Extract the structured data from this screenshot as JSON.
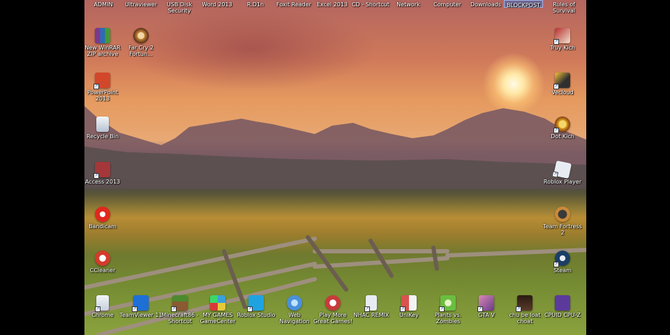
{
  "top_row": [
    {
      "label": "ADMIN",
      "highlight": false
    },
    {
      "label": "Ultraviewer",
      "highlight": false
    },
    {
      "label": "USB Disk Security",
      "highlight": false
    },
    {
      "label": "Word 2013",
      "highlight": false
    },
    {
      "label": "R.D1n",
      "highlight": false
    },
    {
      "label": "Foxit Reader",
      "highlight": false
    },
    {
      "label": "Excel 2013",
      "highlight": false
    },
    {
      "label": "CD - Shortcut",
      "highlight": false
    },
    {
      "label": "Network",
      "highlight": false
    },
    {
      "label": "Computer",
      "highlight": false
    },
    {
      "label": "Downloads",
      "highlight": false
    },
    {
      "label": "BLOCKPOST",
      "highlight": true
    },
    {
      "label": "Rules of Survival",
      "highlight": false
    }
  ],
  "left_column": [
    {
      "label": "New WinRAR ZIP archive",
      "icon": "winrar-icon",
      "color": "#7a3a8c"
    },
    {
      "label": "PowerPoint 2013",
      "icon": "powerpoint-icon",
      "color": "#d2472a"
    },
    {
      "label": "Recycle Bin",
      "icon": "recycle-bin-icon",
      "color": "#dfe6ef"
    },
    {
      "label": "Access 2013",
      "icon": "access-icon",
      "color": "#a4373a"
    },
    {
      "label": "Bandicam",
      "icon": "bandicam-icon",
      "color": "#e0281e"
    },
    {
      "label": "CCleaner",
      "icon": "ccleaner-icon",
      "color": "#d43b2a"
    }
  ],
  "second_column": [
    {
      "label": "Far Cry 2 Fortun...",
      "icon": "far-cry-icon",
      "color": "#c98a3a"
    }
  ],
  "right_column": [
    {
      "label": "Truy Kich",
      "icon": "truy-kich-icon",
      "color": "#b62d2d"
    },
    {
      "label": "Vecloud",
      "icon": "vecloud-icon",
      "color": "#2f2f2f"
    },
    {
      "label": "Dot Kich",
      "icon": "dot-kich-icon",
      "color": "#e0a020"
    },
    {
      "label": "Roblox Player",
      "icon": "roblox-player-icon",
      "color": "#e8ecf2"
    },
    {
      "label": "Team Fortress 2",
      "icon": "team-fortress-icon",
      "color": "#3a3a3a"
    },
    {
      "label": "Steam",
      "icon": "steam-icon",
      "color": "#1b3f66"
    }
  ],
  "bottom_row": [
    {
      "label": "Chrome",
      "icon": "chrome-icon",
      "color": "#e8ecf2"
    },
    {
      "label": "TeamViewer 11",
      "icon": "teamviewer-icon",
      "color": "#1e6fd6"
    },
    {
      "label": "Minecraft86 - Shortcut",
      "icon": "minecraft-icon",
      "color": "#4c8a2e"
    },
    {
      "label": "MY GAMES GameCenter",
      "icon": "my-games-icon",
      "color": "#3aa0d8"
    },
    {
      "label": "Roblox Studio",
      "icon": "roblox-studio-icon",
      "color": "#1fa3e0"
    },
    {
      "label": "Web Navigation",
      "icon": "web-navigation-icon",
      "color": "#4a90d9"
    },
    {
      "label": "Play More Great Games!",
      "icon": "play-more-icon",
      "color": "#c83b3b"
    },
    {
      "label": "NHAC REMIX",
      "icon": "nhac-remix-icon",
      "color": "#e8ecf2"
    },
    {
      "label": "UniKey",
      "icon": "unikey-icon",
      "color": "#d9534f"
    },
    {
      "label": "Plants vs. Zombies",
      "icon": "plants-vs-zombies-icon",
      "color": "#6abf3f"
    },
    {
      "label": "GTA V",
      "icon": "gta-v-icon",
      "color": "#d98ab3"
    },
    {
      "label": "chu be loat choat",
      "icon": "chu-be-icon",
      "color": "#5a3a2a"
    },
    {
      "label": "CPUID CPU-Z",
      "icon": "cpu-z-icon",
      "color": "#5b3a9c"
    }
  ]
}
